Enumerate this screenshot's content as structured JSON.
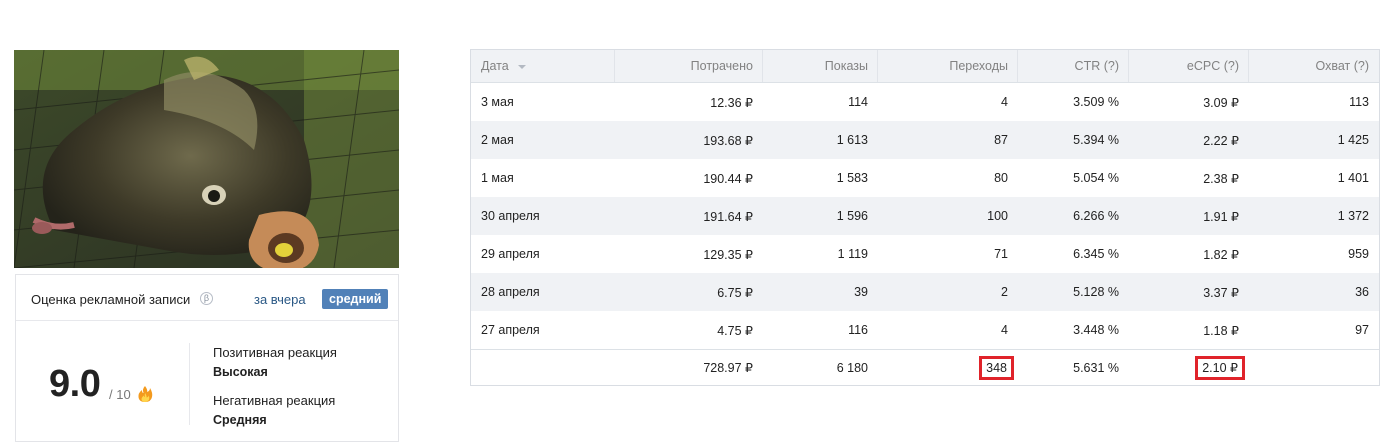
{
  "rating": {
    "title": "Оценка рекламной записи",
    "info_glyph": "β",
    "period_link": "за вчера",
    "level_badge": "средний",
    "score": "9.0",
    "score_max": "/ 10",
    "positive_label": "Позитивная реакция",
    "positive_value": "Высокая",
    "negative_label": "Негативная реакция",
    "negative_value": "Средняя",
    "icons": {
      "info": "info-icon",
      "fire": "fire-icon"
    }
  },
  "table": {
    "headers": [
      "Дата",
      "Потрачено",
      "Показы",
      "Переходы",
      "CTR (?)",
      "eCPC (?)",
      "Охват (?)"
    ],
    "rows": [
      [
        "3 мая",
        "12.36 ₽",
        "114",
        "4",
        "3.509 %",
        "3.09 ₽",
        "113"
      ],
      [
        "2 мая",
        "193.68 ₽",
        "1 613",
        "87",
        "5.394 %",
        "2.22 ₽",
        "1 425"
      ],
      [
        "1 мая",
        "190.44 ₽",
        "1 583",
        "80",
        "5.054 %",
        "2.38 ₽",
        "1 401"
      ],
      [
        "30 апреля",
        "191.64 ₽",
        "1 596",
        "100",
        "6.266 %",
        "1.91 ₽",
        "1 372"
      ],
      [
        "29 апреля",
        "129.35 ₽",
        "1 119",
        "71",
        "6.345 %",
        "1.82 ₽",
        "959"
      ],
      [
        "28 апреля",
        "6.75 ₽",
        "39",
        "2",
        "5.128 %",
        "3.37 ₽",
        "36"
      ],
      [
        "27 апреля",
        "4.75 ₽",
        "116",
        "4",
        "3.448 %",
        "1.18 ₽",
        "97"
      ]
    ],
    "total": [
      "",
      "728.97 ₽",
      "6 180",
      "348",
      "5.631 %",
      "2.10 ₽",
      ""
    ]
  },
  "colors": {
    "accent": "#5181b8",
    "highlight": "#e0232a",
    "link": "#2a5885"
  }
}
